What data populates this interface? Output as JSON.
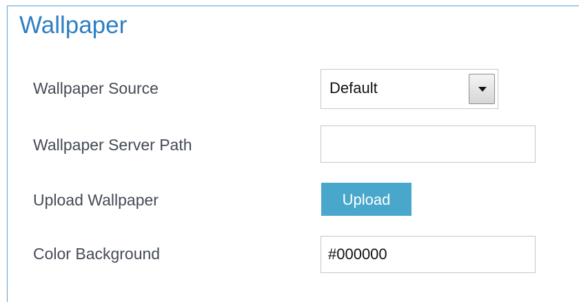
{
  "section": {
    "title": "Wallpaper"
  },
  "fields": {
    "source": {
      "label": "Wallpaper Source",
      "value": "Default"
    },
    "server_path": {
      "label": "Wallpaper Server Path",
      "value": ""
    },
    "upload": {
      "label": "Upload Wallpaper",
      "button_label": "Upload"
    },
    "color_background": {
      "label": "Color Background",
      "value": "#000000"
    }
  },
  "colors": {
    "title": "#2e7fc2",
    "label": "#444a55",
    "accent_button": "#49a7cc",
    "panel_border": "#5aa2d6"
  },
  "icons": {
    "dropdown": "chevron-down-icon"
  }
}
